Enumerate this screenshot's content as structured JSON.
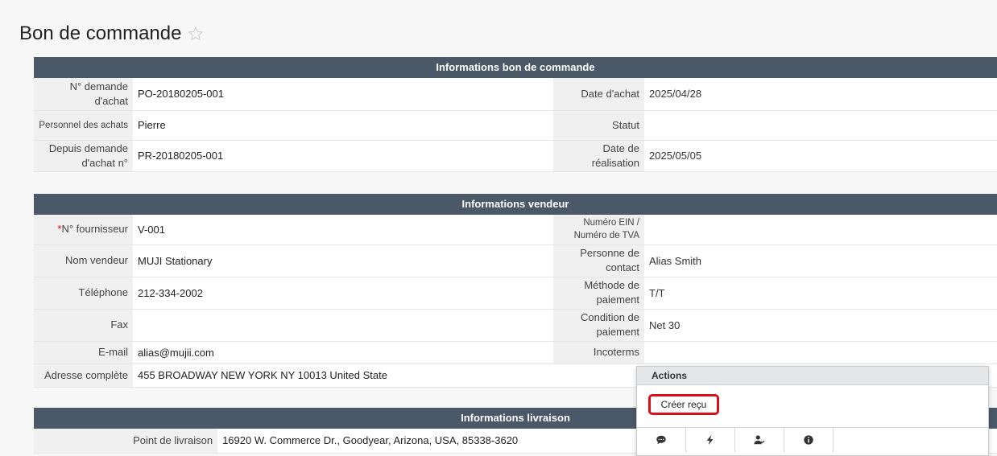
{
  "page": {
    "title": "Bon de commande"
  },
  "po_info": {
    "header": "Informations bon de commande",
    "rows": [
      {
        "l1": "N° demande d'achat",
        "v1": "PO-20180205-001",
        "l2": "Date d'achat",
        "v2": "2025/04/28"
      },
      {
        "l1": "Personnel des achats",
        "v1": "Pierre",
        "l2": "Statut",
        "v2": ""
      },
      {
        "l1": "Depuis demande d'achat n°",
        "v1": "PR-20180205-001",
        "l2": "Date de réalisation",
        "v2": "2025/05/05"
      }
    ]
  },
  "vendor_info": {
    "header": "Informations vendeur",
    "rows": [
      {
        "l1_req": "*",
        "l1": "N° fournisseur",
        "v1": "V-001",
        "l2": "Numéro EIN / Numéro de TVA",
        "v2": ""
      },
      {
        "l1": "Nom vendeur",
        "v1": "MUJI Stationary",
        "l2": "Personne de contact",
        "v2": "Alias Smith"
      },
      {
        "l1": "Téléphone",
        "v1": "212-334-2002",
        "l2": "Méthode de paiement",
        "v2": "T/T"
      },
      {
        "l1": "Fax",
        "v1": "",
        "l2": "Condition de paiement",
        "v2": "Net 30"
      },
      {
        "l1": "E-mail",
        "v1": "alias@mujii.com",
        "l2": "Incoterms",
        "v2": ""
      },
      {
        "l1": "Adresse complète",
        "v1": "455 BROADWAY NEW YORK NY 10013 United State"
      }
    ]
  },
  "delivery_info": {
    "header": "Informations livraison",
    "rows": [
      {
        "l1": "Point de livraison",
        "v1": "16920 W. Commerce Dr., Goodyear, Arizona, USA, 85338-3620"
      }
    ]
  },
  "actions": {
    "header": "Actions",
    "button": "Créer reçu",
    "icons": [
      "comment-icon",
      "lightning-icon",
      "user-check-icon",
      "info-icon"
    ]
  }
}
